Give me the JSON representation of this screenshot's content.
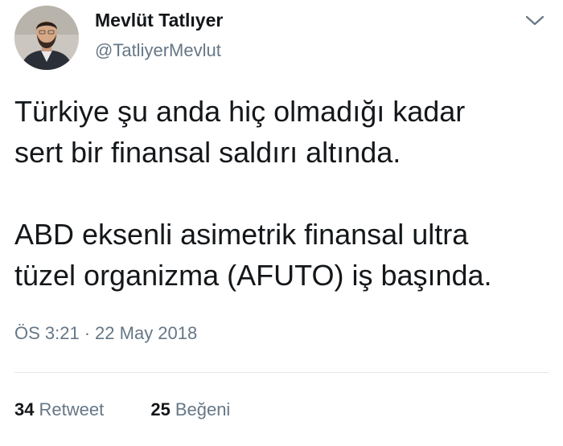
{
  "author": {
    "name": "Mevlüt Tatlıyer",
    "handle": "@TatliyerMevlut"
  },
  "tweet": {
    "paragraphs": [
      "Türkiye şu anda hiç olmadığı kadar\nsert bir finansal saldırı altında.",
      "ABD eksenli asimetrik finansal ultra\ntüzel organizma (AFUTO) iş başında."
    ],
    "time": "ÖS 3:21",
    "separator": "·",
    "date": "22 May 2018"
  },
  "stats": {
    "retweets_count": "34",
    "retweets_label": "Retweet",
    "likes_count": "25",
    "likes_label": "Beğeni"
  },
  "icons": {
    "menu": "chevron-down-icon"
  },
  "colors": {
    "text": "#14171a",
    "secondary": "#657786",
    "divider": "#e1e8ed"
  }
}
